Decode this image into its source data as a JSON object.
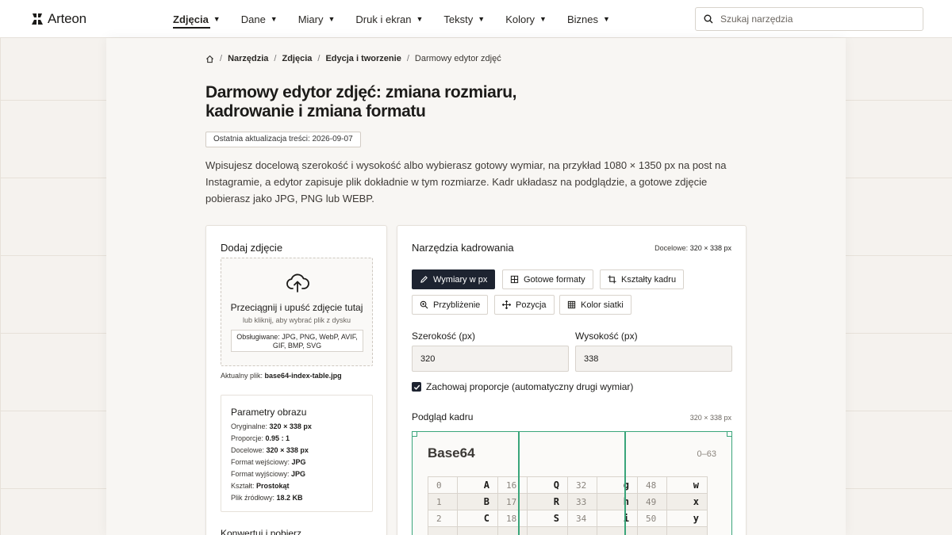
{
  "header": {
    "logo_text": "Arteon",
    "logo_icon": "arteon-logo-icon",
    "nav": [
      {
        "label": "Zdjęcia",
        "active": true
      },
      {
        "label": "Dane"
      },
      {
        "label": "Miary"
      },
      {
        "label": "Druk i ekran"
      },
      {
        "label": "Teksty"
      },
      {
        "label": "Kolory"
      },
      {
        "label": "Biznes"
      }
    ],
    "search_placeholder": "Szukaj narzędzia",
    "search_icon": "search-icon"
  },
  "breadcrumb": {
    "home_icon": "home-icon",
    "items": [
      "Narzędzia",
      "Zdjęcia",
      "Edycja i tworzenie"
    ],
    "current": "Darmowy edytor zdjęć"
  },
  "page": {
    "title": "Darmowy edytor zdjęć: zmiana rozmiaru, kadrowanie i zmiana formatu",
    "updated": "Ostatnia aktualizacja treści: 2026-09-07",
    "intro": "Wpisujesz docelową szerokość i wysokość albo wybierasz gotowy wymiar, na przykład 1080 × 1350 px na post na Instagramie, a edytor zapisuje plik dokładnie w tym rozmiarze. Kadr układasz na podglądzie, a gotowe zdjęcie pobierasz jako JPG, PNG lub WEBP."
  },
  "upload": {
    "title": "Dodaj zdjęcie",
    "drop_title": "Przeciągnij i upuść zdjęcie tutaj",
    "drop_sub": "lub kliknij, aby wybrać plik z dysku",
    "formats": "Obsługiwane: JPG, PNG, WebP, AVIF, GIF, BMP, SVG",
    "current_label": "Aktualny plik:",
    "current_file": "base64-index-table.jpg"
  },
  "params": {
    "title": "Parametry obrazu",
    "rows": [
      {
        "label": "Oryginalne:",
        "value": "320 × 338 px"
      },
      {
        "label": "Proporcje:",
        "value": "0.95 : 1"
      },
      {
        "label": "Docelowe:",
        "value": "320 × 338 px"
      },
      {
        "label": "Format wejściowy:",
        "value": "JPG"
      },
      {
        "label": "Format wyjściowy:",
        "value": "JPG"
      },
      {
        "label": "Kształt:",
        "value": "Prostokąt"
      },
      {
        "label": "Plik źródłowy:",
        "value": "18.2 KB"
      }
    ]
  },
  "convert_title": "Konwertuj i pobierz",
  "crop": {
    "title": "Narzędzia kadrowania",
    "target_label": "Docelowe:",
    "target_value": "320 × 338 px",
    "buttons": [
      {
        "label": "Wymiary w px",
        "icon": "pencil-icon",
        "active": true
      },
      {
        "label": "Gotowe formaty",
        "icon": "grid-icon"
      },
      {
        "label": "Kształty kadru",
        "icon": "crop-icon"
      },
      {
        "label": "Przybliżenie",
        "icon": "zoom-icon"
      },
      {
        "label": "Pozycja",
        "icon": "move-icon"
      },
      {
        "label": "Kolor siatki",
        "icon": "grid-color-icon"
      }
    ],
    "width_label": "Szerokość (px)",
    "width_value": "320",
    "height_label": "Wysokość (px)",
    "height_value": "338",
    "keep_ratio_label": "Zachowaj proporcje (automatyczny drugi wymiar)",
    "keep_ratio": true,
    "preview_title": "Podgląd kadru",
    "preview_size": "320 × 338 px",
    "grid_color": "#3aa57a"
  },
  "preview_image": {
    "title": "Base64",
    "range": "0–63",
    "rows": [
      [
        "0",
        "A",
        "16",
        "Q",
        "32",
        "g",
        "48",
        "w"
      ],
      [
        "1",
        "B",
        "17",
        "R",
        "33",
        "h",
        "49",
        "x"
      ],
      [
        "2",
        "C",
        "18",
        "S",
        "34",
        "i",
        "50",
        "y"
      ]
    ]
  }
}
